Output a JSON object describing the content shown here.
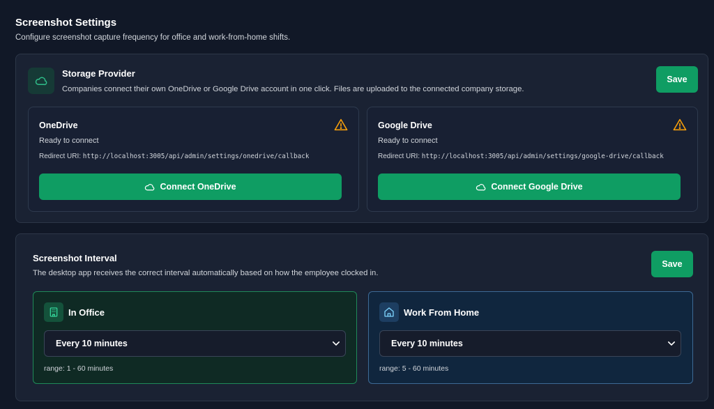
{
  "page": {
    "title": "Screenshot Settings",
    "subtitle": "Configure screenshot capture frequency for office and work-from-home shifts."
  },
  "storage": {
    "title": "Storage Provider",
    "description": "Companies connect their own OneDrive or Google Drive account in one click. Files are uploaded to the connected company storage.",
    "save_label": "Save",
    "icon": "cloud-icon",
    "providers": [
      {
        "name": "OneDrive",
        "status": "Ready to connect",
        "uri_label": "Redirect URI:",
        "uri": "http://localhost:3005/api/admin/settings/onedrive/callback",
        "button_label": "Connect OneDrive",
        "warning_icon": "warning-icon"
      },
      {
        "name": "Google Drive",
        "status": "Ready to connect",
        "uri_label": "Redirect URI:",
        "uri": "http://localhost:3005/api/admin/settings/google-drive/callback",
        "button_label": "Connect Google Drive",
        "warning_icon": "warning-icon"
      }
    ]
  },
  "interval": {
    "title": "Screenshot Interval",
    "description": "The desktop app receives the correct interval automatically based on how the employee clocked in.",
    "save_label": "Save",
    "shifts": [
      {
        "name": "In Office",
        "icon": "building-icon",
        "selected": "Every 10 minutes",
        "range": "range: 1 - 60 minutes"
      },
      {
        "name": "Work From Home",
        "icon": "home-icon",
        "selected": "Every 10 minutes",
        "range": "range: 5 - 60 minutes"
      }
    ]
  },
  "colors": {
    "background": "#111827",
    "panel": "#1a2233",
    "accent_green": "#0f9d63",
    "warning": "#f59e0b",
    "office_border": "#1f8a59",
    "wfh_border": "#3d6a96"
  }
}
